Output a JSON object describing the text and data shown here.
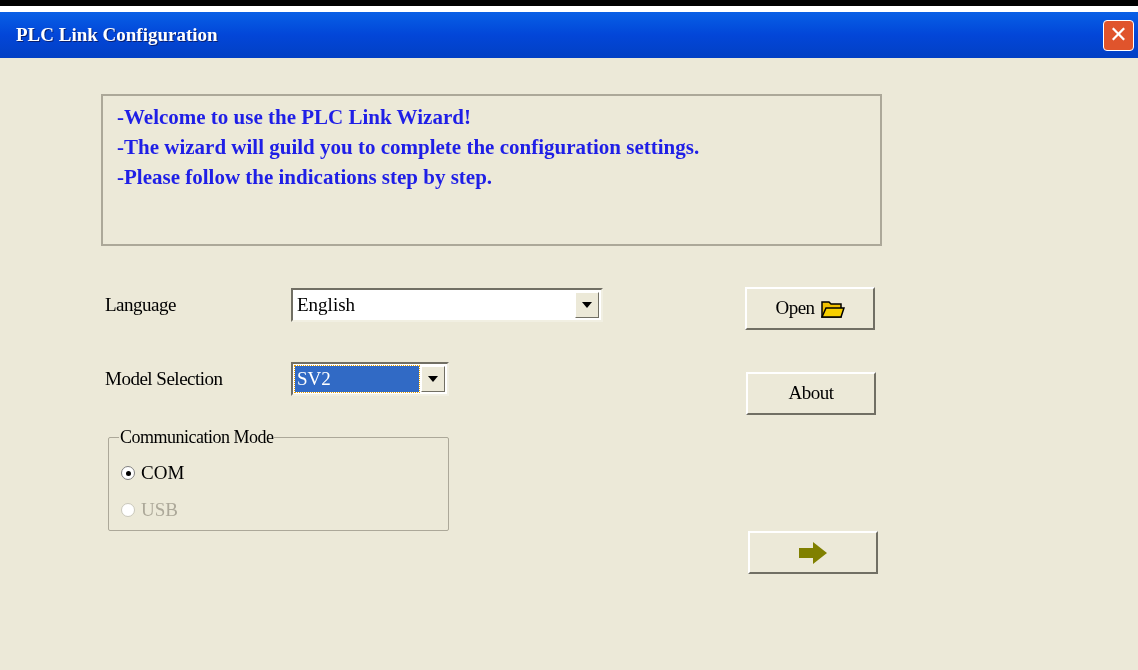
{
  "window": {
    "title": "PLC Link Configuration",
    "close": "✕"
  },
  "welcome_lines": [
    "-Welcome to use the PLC Link Wizard!",
    "-The wizard will guild you to complete the configuration settings.",
    "-Please follow the indications step by step."
  ],
  "fields": [
    {
      "label": "Language",
      "value": "English",
      "focused": false
    },
    {
      "label": "Model Selection",
      "value": "SV2",
      "focused": true
    }
  ],
  "communication_mode": {
    "title": "Communication Mode",
    "options": [
      {
        "label": "COM",
        "selected": true,
        "disabled": false
      },
      {
        "label": "USB",
        "selected": false,
        "disabled": true
      }
    ]
  },
  "buttons": [
    {
      "kind": "open",
      "label": "Open"
    },
    {
      "kind": "about",
      "label": "About"
    },
    {
      "kind": "next"
    }
  ]
}
